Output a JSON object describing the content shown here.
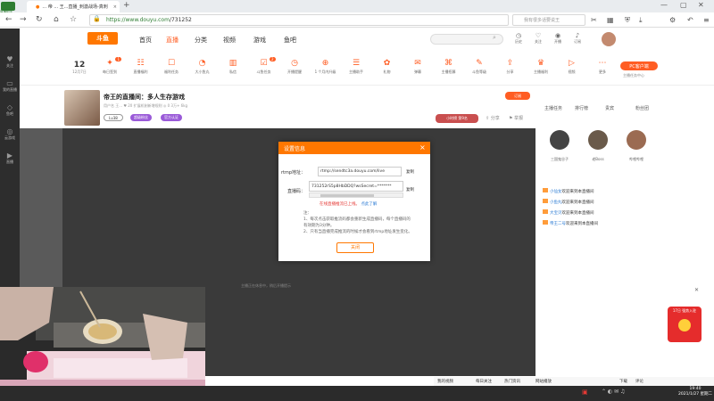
{
  "browser": {
    "left_label": "直播助手",
    "tab_title": "... 帝 ... 王...直播_刺激战场-真刺",
    "url_prefix": "https://",
    "url_host": "www.douyu.com",
    "url_path": "/731252",
    "search_placeholder": "我有很多话要说王"
  },
  "left_sidebar": [
    {
      "label": "关注",
      "icon": "heart-icon"
    },
    {
      "label": "我的直播",
      "icon": "tv-icon"
    },
    {
      "label": "鱼吧",
      "icon": "fish-icon"
    },
    {
      "label": "云游戏",
      "icon": "gamepad-icon"
    },
    {
      "label": "直播",
      "icon": "play-icon"
    }
  ],
  "topnav": {
    "logo": "斗鱼",
    "items": [
      "首页",
      "直播",
      "分类",
      "视频",
      "游戏",
      "鱼吧"
    ],
    "active": "直播",
    "icons": [
      {
        "label": "历史",
        "icon": "clock-icon"
      },
      {
        "label": "关注",
        "icon": "heart-icon"
      },
      {
        "label": "开播",
        "icon": "camera-icon"
      },
      {
        "label": "订阅",
        "icon": "bell-icon"
      }
    ]
  },
  "categories": {
    "date_day": "12",
    "date_label": "12月7日",
    "items": [
      {
        "label": "每日签到",
        "badge": "1"
      },
      {
        "label": "直播福利",
        "badge": ""
      },
      {
        "label": "福利任务",
        "badge": ""
      },
      {
        "label": "大小鱼丸",
        "badge": ""
      },
      {
        "label": "私信",
        "badge": ""
      },
      {
        "label": "斗鱼任务",
        "badge": "2"
      },
      {
        "label": "开播提醒",
        "badge": ""
      },
      {
        "label": "1 个月内升级",
        "badge": ""
      },
      {
        "label": "主播助手",
        "badge": ""
      },
      {
        "label": "礼物",
        "badge": ""
      },
      {
        "label": "弹幕",
        "badge": ""
      },
      {
        "label": "主播招募",
        "badge": ""
      },
      {
        "label": "斗鱼等级",
        "badge": ""
      },
      {
        "label": "分享",
        "badge": ""
      },
      {
        "label": "主播福利",
        "badge": ""
      },
      {
        "label": "视频",
        "badge": ""
      },
      {
        "label": "更多",
        "badge": ""
      }
    ],
    "pc_btn": "PC客户端",
    "pc_sub": "主播任务中心"
  },
  "room": {
    "title": "帝王的直播间：多人生存游戏",
    "meta": "用户名  王...  ♥ 20  扩展机制新增规则  ◎ 0  3万+ 6kg",
    "level": "Lv38",
    "tag1": "超级粉丝",
    "tag2": "官方认证",
    "sub": "订阅",
    "rank": "小时榜 第9名",
    "video_tip": "主播正在休息中，稍后开播提示"
  },
  "right_panel": {
    "tabs": [
      "主播任务",
      "排行榜",
      "贵宾",
      "粉丝团"
    ],
    "active_tab": "主播任务",
    "users": [
      {
        "name": "三国鬼谷子",
        "color": "#444"
      },
      {
        "name": "老Boss",
        "color": "#6a5a4a"
      },
      {
        "name": "哔哩哔哩",
        "color": "#9b6b52"
      }
    ],
    "messages": [
      {
        "user": "小仙女",
        "text": "欢迎来到本直播间"
      },
      {
        "user": "小鱼丸",
        "text": "欢迎来到本直播间"
      },
      {
        "user": "大宝贝",
        "text": "欢迎来到本直播间"
      },
      {
        "user": "帝王二号",
        "text": "欢迎来到本直播间"
      }
    ],
    "promo": "17日 强势入驻"
  },
  "bottom_bar": [
    "我的视频",
    "每日关注",
    "热门资讯",
    "网站播放",
    "下载",
    "评论"
  ],
  "dialog": {
    "title": "设置信息",
    "rtmp_label": "rtmp地址：",
    "rtmp_value": "rtmp://sendtc3a.douyu.com/live",
    "key_label": "直播码：",
    "key_value": "731252rS5p8HbDDQ?wsSecret=*******",
    "copy": "复制",
    "warn": "在线直播推流已上线。",
    "warn_link": "点此了解",
    "note_head": "注：",
    "note1": "1、每次点击获取推流码都会重新生成直播码，每个直播码的有效期为3分钟。",
    "note2": "2、只有当直播完成推流的时候才会看到rtmp地址发生变化。",
    "close_btn": "关闭"
  },
  "taskbar": {
    "time": "19:40",
    "date": "2021/1/27 星期二"
  }
}
